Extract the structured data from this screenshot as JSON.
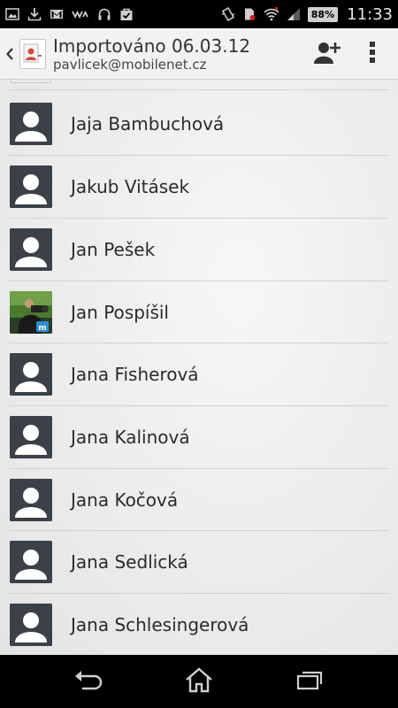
{
  "status_bar": {
    "battery": "88%",
    "time": "11:33",
    "left_icons": [
      "image-icon",
      "download-icon",
      "gmail-icon",
      "walkman-icon",
      "headphones-icon",
      "bag-check-icon"
    ],
    "right_icons": [
      "vibrate-icon",
      "sim-icon",
      "wifi-icon",
      "signal-icon",
      "battery-icon"
    ]
  },
  "action_bar": {
    "title": "Importováno 06.03.12",
    "subtitle": "pavlicek@mobilenet.cz",
    "add_contact_icon": "add-person-icon",
    "overflow_icon": "overflow-menu-icon"
  },
  "contacts": [
    {
      "name": "Jaja Bambuchová",
      "photo": "placeholder"
    },
    {
      "name": "Jakub Vitásek",
      "photo": "placeholder"
    },
    {
      "name": "Jan Pešek",
      "photo": "placeholder"
    },
    {
      "name": "Jan Pospíšil",
      "photo": "photo"
    },
    {
      "name": "Jana Fisherová",
      "photo": "placeholder"
    },
    {
      "name": "Jana Kalinová",
      "photo": "placeholder"
    },
    {
      "name": "Jana Kočová",
      "photo": "placeholder"
    },
    {
      "name": "Jana Sedlická",
      "photo": "placeholder"
    },
    {
      "name": "Jana Schlesingerová",
      "photo": "placeholder"
    }
  ],
  "nav_bar": {
    "icons": [
      "back-icon",
      "home-icon",
      "recent-apps-icon"
    ]
  },
  "colors": {
    "status_bar_bg": "#000000",
    "action_bar_bg": "#f2f2f2",
    "avatar_bg": "#3b4147",
    "text": "#2b2b2b"
  }
}
